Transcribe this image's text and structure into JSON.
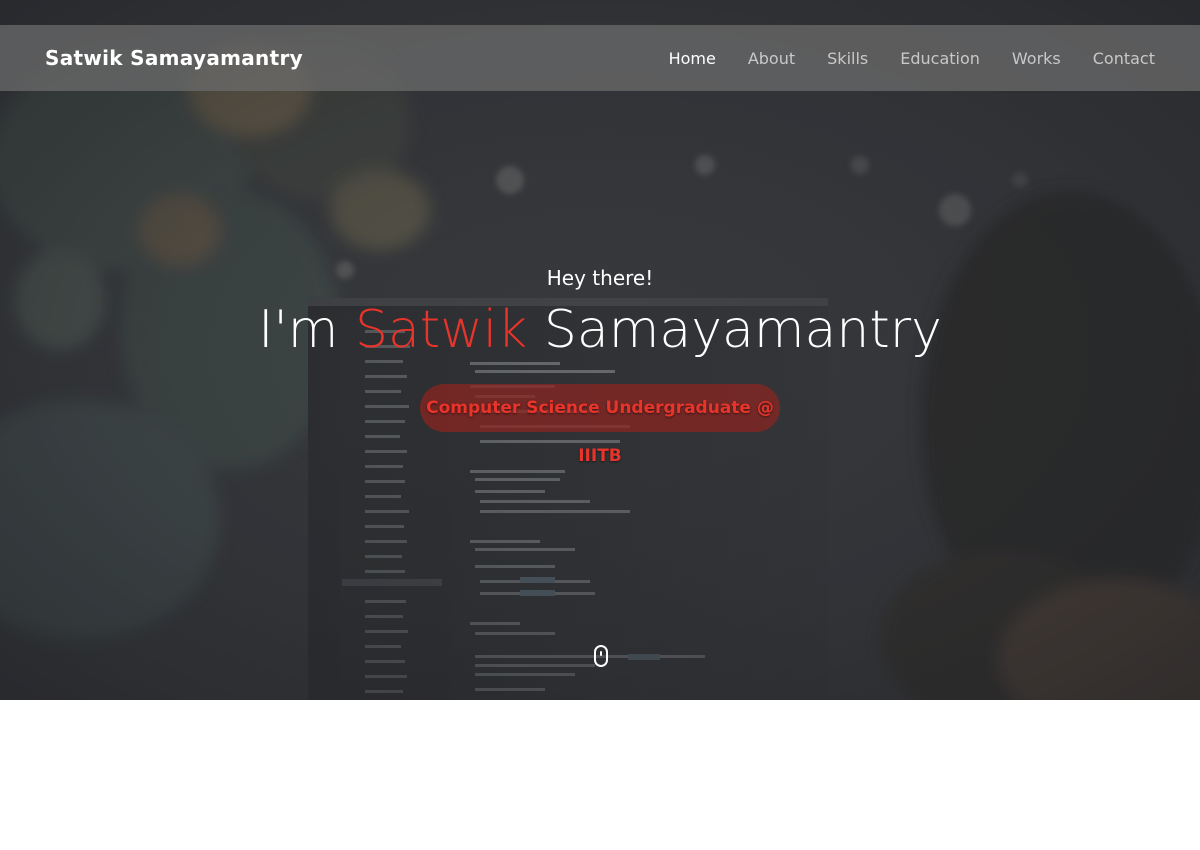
{
  "navbar": {
    "brand": "Satwik Samayamantry",
    "links": [
      {
        "label": "Home",
        "active": true
      },
      {
        "label": "About",
        "active": false
      },
      {
        "label": "Skills",
        "active": false
      },
      {
        "label": "Education",
        "active": false
      },
      {
        "label": "Works",
        "active": false
      },
      {
        "label": "Contact",
        "active": false
      }
    ]
  },
  "hero": {
    "greeting": "Hey there!",
    "headline_prefix": "I'm",
    "headline_first_name": "Satwik",
    "headline_last_name": "Samayamantry",
    "tagline": "Computer Science Undergraduate @ IIITB",
    "scroll_icon": "mouse-scroll-icon"
  },
  "colors": {
    "accent": "#e8342a",
    "navbar_bg": "#6e6e6e",
    "hero_overlay": "#33353a",
    "tagline_bg": "#8a2622"
  }
}
